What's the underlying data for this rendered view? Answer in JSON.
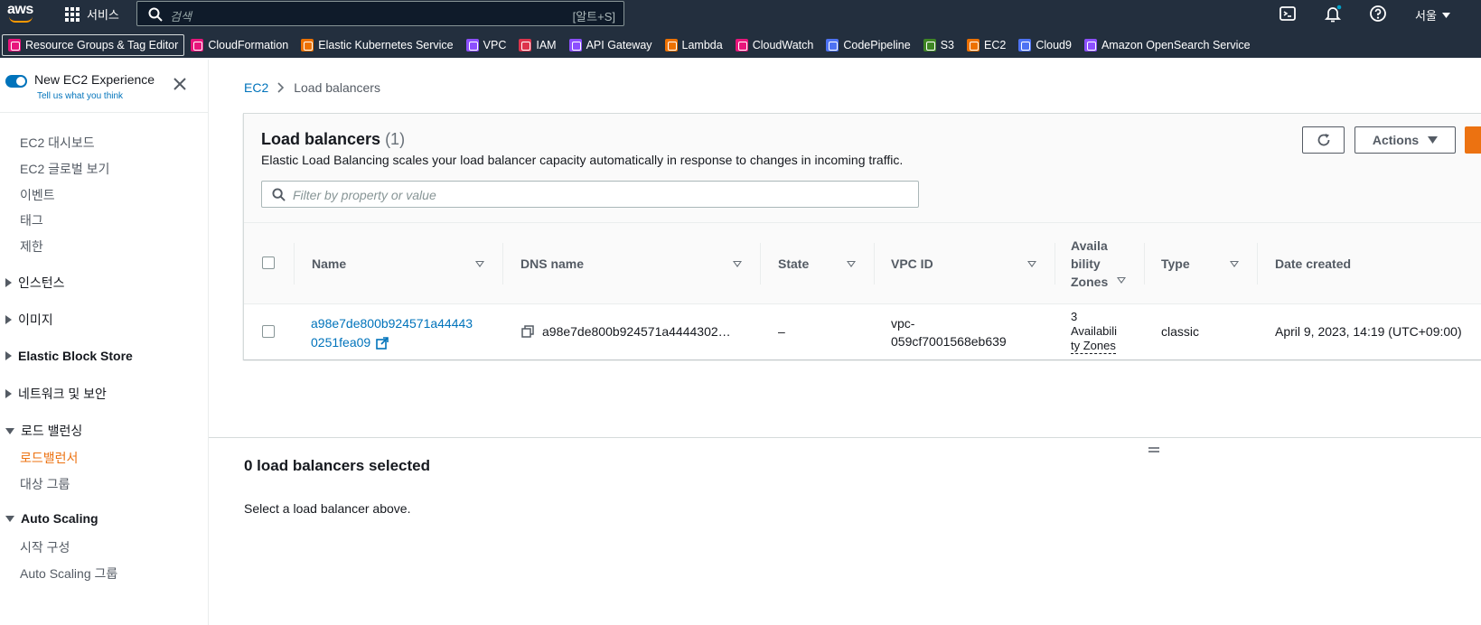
{
  "topnav": {
    "logo_text": "aws",
    "services_label": "서비스",
    "search_placeholder": "검색",
    "search_shortcut": "[알트+S]",
    "region_label": "서울",
    "icons": [
      "cloudshell-icon",
      "notifications-icon",
      "help-icon"
    ]
  },
  "favorites": [
    {
      "label": "Resource Groups & Tag Editor",
      "color": "#e7157b",
      "icon": "resource-groups-icon"
    },
    {
      "label": "CloudFormation",
      "color": "#e7157b",
      "icon": "cloudformation-icon"
    },
    {
      "label": "Elastic Kubernetes Service",
      "color": "#ed7100",
      "icon": "eks-icon"
    },
    {
      "label": "VPC",
      "color": "#8c4fff",
      "icon": "vpc-icon"
    },
    {
      "label": "IAM",
      "color": "#dd344c",
      "icon": "iam-icon"
    },
    {
      "label": "API Gateway",
      "color": "#8c4fff",
      "icon": "api-gateway-icon"
    },
    {
      "label": "Lambda",
      "color": "#ed7100",
      "icon": "lambda-icon"
    },
    {
      "label": "CloudWatch",
      "color": "#e7157b",
      "icon": "cloudwatch-icon"
    },
    {
      "label": "CodePipeline",
      "color": "#4d72f3",
      "icon": "codepipeline-icon"
    },
    {
      "label": "S3",
      "color": "#3f8624",
      "icon": "s3-icon"
    },
    {
      "label": "EC2",
      "color": "#ed7100",
      "icon": "ec2-icon"
    },
    {
      "label": "Cloud9",
      "color": "#4d72f3",
      "icon": "cloud9-icon"
    },
    {
      "label": "Amazon OpenSearch Service",
      "color": "#8c4fff",
      "icon": "opensearch-icon"
    }
  ],
  "sidebar": {
    "toggle_label": "New EC2 Experience",
    "toggle_sub": "Tell us what you think",
    "toggle_on": true,
    "items": [
      {
        "label": "EC2 대시보드",
        "kind": "item"
      },
      {
        "label": "EC2 글로벌 보기",
        "kind": "item"
      },
      {
        "label": "이벤트",
        "kind": "item"
      },
      {
        "label": "태그",
        "kind": "item"
      },
      {
        "label": "제한",
        "kind": "item"
      },
      {
        "label": "인스턴스",
        "kind": "section-collapsed"
      },
      {
        "label": "이미지",
        "kind": "section-collapsed"
      },
      {
        "label": "Elastic Block Store",
        "kind": "section-collapsed-bold"
      },
      {
        "label": "네트워크 및 보안",
        "kind": "section-collapsed"
      },
      {
        "label": "로드 밸런싱",
        "kind": "section-expanded"
      },
      {
        "label": "로드밸런서",
        "kind": "item-active"
      },
      {
        "label": "대상 그룹",
        "kind": "item"
      },
      {
        "label": "Auto Scaling",
        "kind": "section-expanded-bold"
      },
      {
        "label": "시작 구성",
        "kind": "item"
      },
      {
        "label": "Auto Scaling 그룹",
        "kind": "item"
      }
    ]
  },
  "breadcrumb": {
    "root": "EC2",
    "current": "Load balancers"
  },
  "panel": {
    "title": "Load balancers",
    "count": "(1)",
    "description": "Elastic Load Balancing scales your load balancer capacity automatically in response to changes in incoming traffic.",
    "filter_placeholder": "Filter by property or value",
    "actions_label": "Actions"
  },
  "table": {
    "columns": [
      "Name",
      "DNS name",
      "State",
      "VPC ID",
      "Availa bility Zones",
      "Type",
      "Date created"
    ],
    "rows": [
      {
        "name_line1": "a98e7de800b924571a44443",
        "name_line2": "0251fea09",
        "dns_name": "a98e7de800b924571a4444302…",
        "state": "–",
        "vpc_line1": "vpc-",
        "vpc_line2": "059cf7001568eb639",
        "az_line1": "3",
        "az_line2": "Availabili",
        "az_line3": "ty Zones",
        "type": "classic",
        "date_created": "April 9, 2023, 14:19 (UTC+09:00)"
      }
    ]
  },
  "split": {
    "title": "0 load balancers selected",
    "text": "Select a load balancer above."
  },
  "colors": {
    "topnav_bg": "#232f3e",
    "link": "#0073bb",
    "accent": "#ec7211"
  }
}
